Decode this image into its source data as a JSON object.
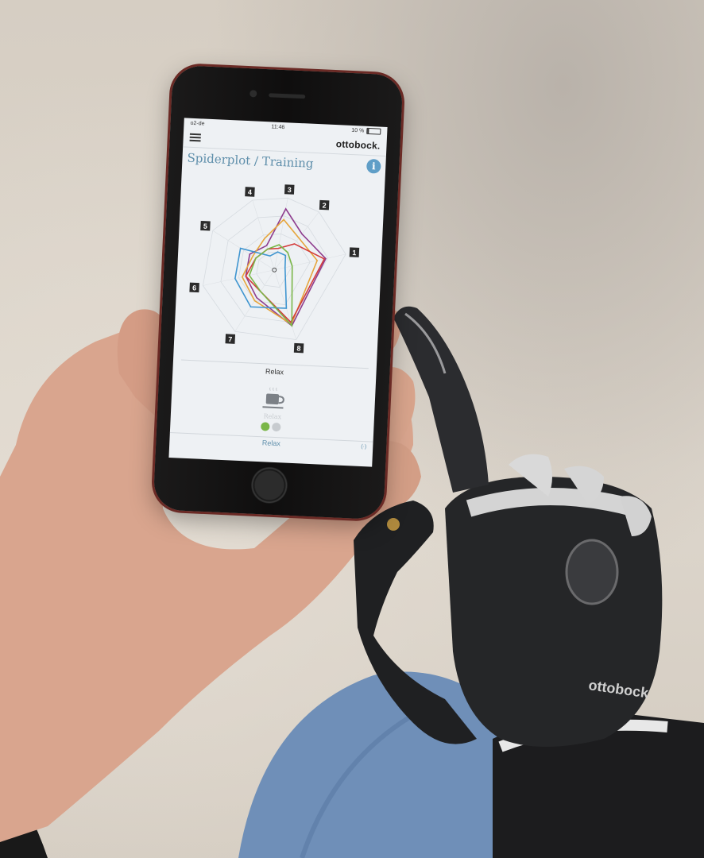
{
  "status_bar": {
    "carrier": "o2-de",
    "time": "11:46",
    "battery": "10 %"
  },
  "app": {
    "brand": "ottobock.",
    "title": "Spiderplot / Training",
    "info_icon": "info-icon",
    "menu_icon": "hamburger-menu-icon"
  },
  "chart_data": {
    "type": "radar",
    "axes": [
      "1",
      "2",
      "3",
      "4",
      "5",
      "6",
      "7",
      "8"
    ],
    "series": [
      {
        "color": "#8e3d8e",
        "values": [
          0.72,
          0.62,
          0.85,
          0.35,
          0.4,
          0.4,
          0.45,
          0.8
        ]
      },
      {
        "color": "#e6a53c",
        "values": [
          0.6,
          0.55,
          0.7,
          0.45,
          0.35,
          0.45,
          0.5,
          0.78
        ]
      },
      {
        "color": "#d43b3b",
        "values": [
          0.7,
          0.45,
          0.3,
          0.3,
          0.3,
          0.4,
          0.35,
          0.75
        ]
      },
      {
        "color": "#3f95d0",
        "values": [
          0.15,
          0.25,
          0.25,
          0.2,
          0.55,
          0.55,
          0.6,
          0.55
        ]
      },
      {
        "color": "#7ab648",
        "values": [
          0.25,
          0.3,
          0.35,
          0.3,
          0.3,
          0.35,
          0.35,
          0.8
        ]
      }
    ]
  },
  "mode": {
    "label": "Relax",
    "cup_label": "Relax",
    "icon": "coffee-cup-icon"
  },
  "indicators": {
    "active_color": "#7ab648",
    "inactive_color": "#c7cbcf"
  },
  "bottom_bar": {
    "label": "Relax",
    "icon": "bluetooth-connection-icon"
  },
  "device_text": "ottobock"
}
